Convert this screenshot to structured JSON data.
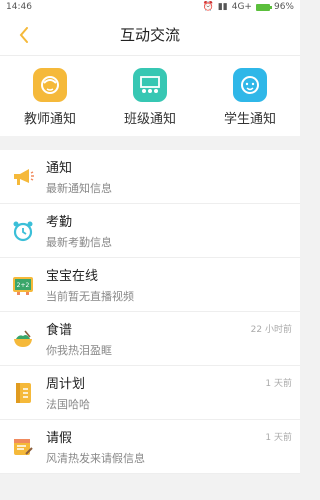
{
  "status": {
    "time": "14:46",
    "network": "4G+",
    "battery": "96%"
  },
  "header": {
    "title": "互动交流"
  },
  "quick": [
    {
      "label": "教师通知",
      "icon": "teacher-icon",
      "color": "#f5b93a"
    },
    {
      "label": "班级通知",
      "icon": "classroom-icon",
      "color": "#37c7b3"
    },
    {
      "label": "学生通知",
      "icon": "student-icon",
      "color": "#2fb7e8"
    }
  ],
  "items": [
    {
      "title": "通知",
      "subtitle": "最新通知信息",
      "time": "",
      "icon": "megaphone-icon"
    },
    {
      "title": "考勤",
      "subtitle": "最新考勤信息",
      "time": "",
      "icon": "alarm-clock-icon"
    },
    {
      "title": "宝宝在线",
      "subtitle": "当前暂无直播视频",
      "time": "",
      "icon": "tv-icon"
    },
    {
      "title": "食谱",
      "subtitle": "你我热泪盈眶",
      "time": "22 小时前",
      "icon": "bowl-icon"
    },
    {
      "title": "周计划",
      "subtitle": "法国哈哈",
      "time": "1 天前",
      "icon": "notebook-icon"
    },
    {
      "title": "请假",
      "subtitle": "风清热发来请假信息",
      "time": "1 天前",
      "icon": "leave-note-icon"
    }
  ]
}
